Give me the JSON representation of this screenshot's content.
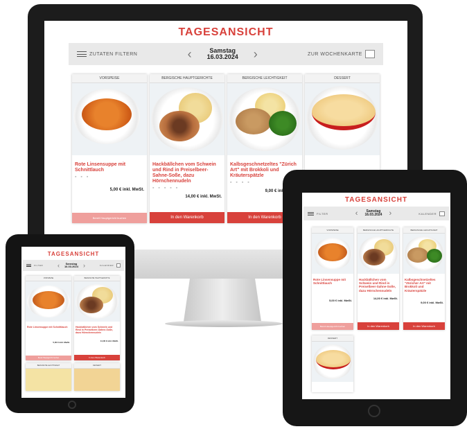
{
  "page_title": "TAGESANSICHT",
  "filter_label_long": "ZUTATEN FILTERN",
  "filter_label_short": "FILTER",
  "weekday": "Samstag",
  "date": "16.03.2024",
  "week_link": "ZUR WOCHENKARTE",
  "calendar_link": "KALENDER",
  "nav_prev": "‹",
  "nav_next": "›",
  "dishes": [
    {
      "category": "VORSPEISE",
      "name": "Rote Linsensuppe mit Schnittlauch",
      "price": "5,00 € inkl. MwSt.",
      "button": "Bereit Hauptgericht buchen",
      "button_enabled": false
    },
    {
      "category": "BERGISCHE HAUPTGERICHTE",
      "name": "Hackbällchen vom Schwein und Rind in Preiselbeer-Sahne-Soße, dazu Hörnchennudeln",
      "price": "14,00 € inkl. MwSt.",
      "button": "In den Warenkorb",
      "button_enabled": true
    },
    {
      "category": "BERGISCHE LEICHTIGKEIT",
      "name": "Kalbsgeschnetzeltes \"Züricher Art\" mit Brokkoli und Kräuterspätzle",
      "price": "9,00 € inkl. MwSt.",
      "button": "In den Warenkorb",
      "button_enabled": true
    },
    {
      "category": "DESSERT",
      "name": "",
      "price": "",
      "button": "",
      "button_enabled": false
    }
  ],
  "monitor_name_3": "Kalbsgeschnetzeltes \"Zürich Art\" mit Brokkoli und Kräuterspätzle",
  "colors": {
    "accent": "#d8413b",
    "bar": "#e9e9e9",
    "frame": "#1c1c1c"
  }
}
